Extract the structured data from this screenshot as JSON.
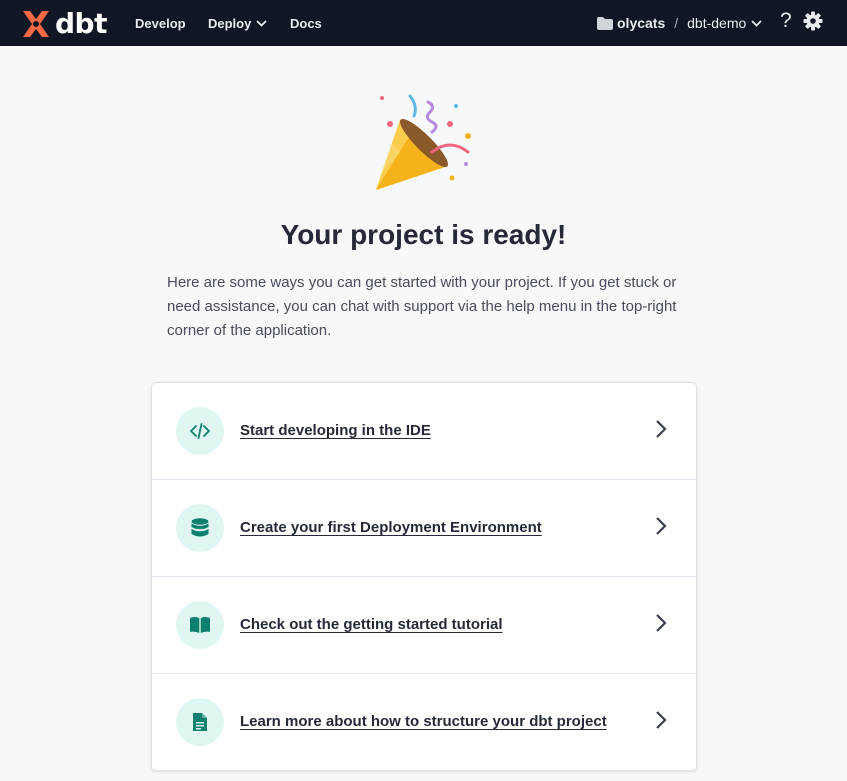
{
  "header": {
    "logo_text": "dbt",
    "nav": {
      "develop": "Develop",
      "deploy": "Deploy",
      "docs": "Docs"
    },
    "account": "olycats",
    "separator": "/",
    "project": "dbt-demo",
    "help_label": "?"
  },
  "main": {
    "title": "Your project is ready!",
    "intro": "Here are some ways you can get started with your project. If you get stuck or need assistance, you can chat with support via the help menu in the top-right corner of the application.",
    "actions": [
      {
        "label": "Start developing in the IDE",
        "icon": "code-icon"
      },
      {
        "label": "Create your first Deployment Environment",
        "icon": "database-icon"
      },
      {
        "label": "Check out the getting started tutorial",
        "icon": "book-icon"
      },
      {
        "label": "Learn more about how to structure your dbt project",
        "icon": "document-icon"
      }
    ]
  },
  "colors": {
    "header_bg": "#101624",
    "brand_orange": "#fe6a43",
    "accent_teal": "#0f7f6e",
    "icon_circle_bg": "#dff6f2"
  }
}
